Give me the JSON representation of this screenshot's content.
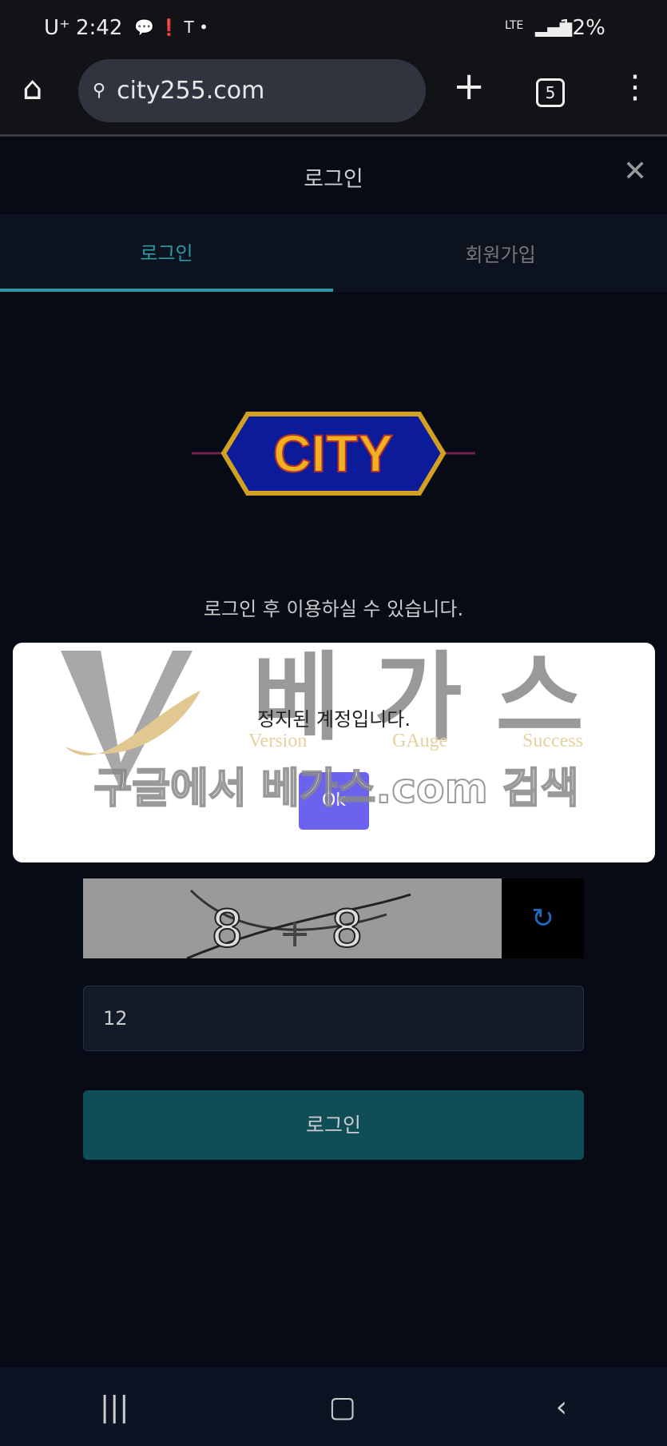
{
  "status_bar": {
    "carrier": "U⁺",
    "time": "2:42",
    "network": "LTE",
    "battery": "12%"
  },
  "browser": {
    "url": "city255.com",
    "tab_count": "5"
  },
  "header": {
    "title": "로그인"
  },
  "tabs": [
    {
      "label": "로그인",
      "active": true
    },
    {
      "label": "회원가입",
      "active": false
    }
  ],
  "logo": {
    "text": "CITY"
  },
  "subtitle": "로그인 후 이용하실 수 있습니다.",
  "dialog": {
    "message": "정지된 계정입니다.",
    "ok_label": "Ok"
  },
  "watermark": {
    "brand": "베가스",
    "tagline": [
      "Version",
      "GAuge",
      "Success"
    ],
    "search_text": "구글에서 베가스.com 검색"
  },
  "captcha": {
    "text": "8 + 8"
  },
  "answer_input": {
    "value": "12"
  },
  "login_button": {
    "label": "로그인"
  },
  "colors": {
    "accent": "#2a9aa5",
    "ok_button": "#6b62ee",
    "login_button": "#0f4d57"
  }
}
